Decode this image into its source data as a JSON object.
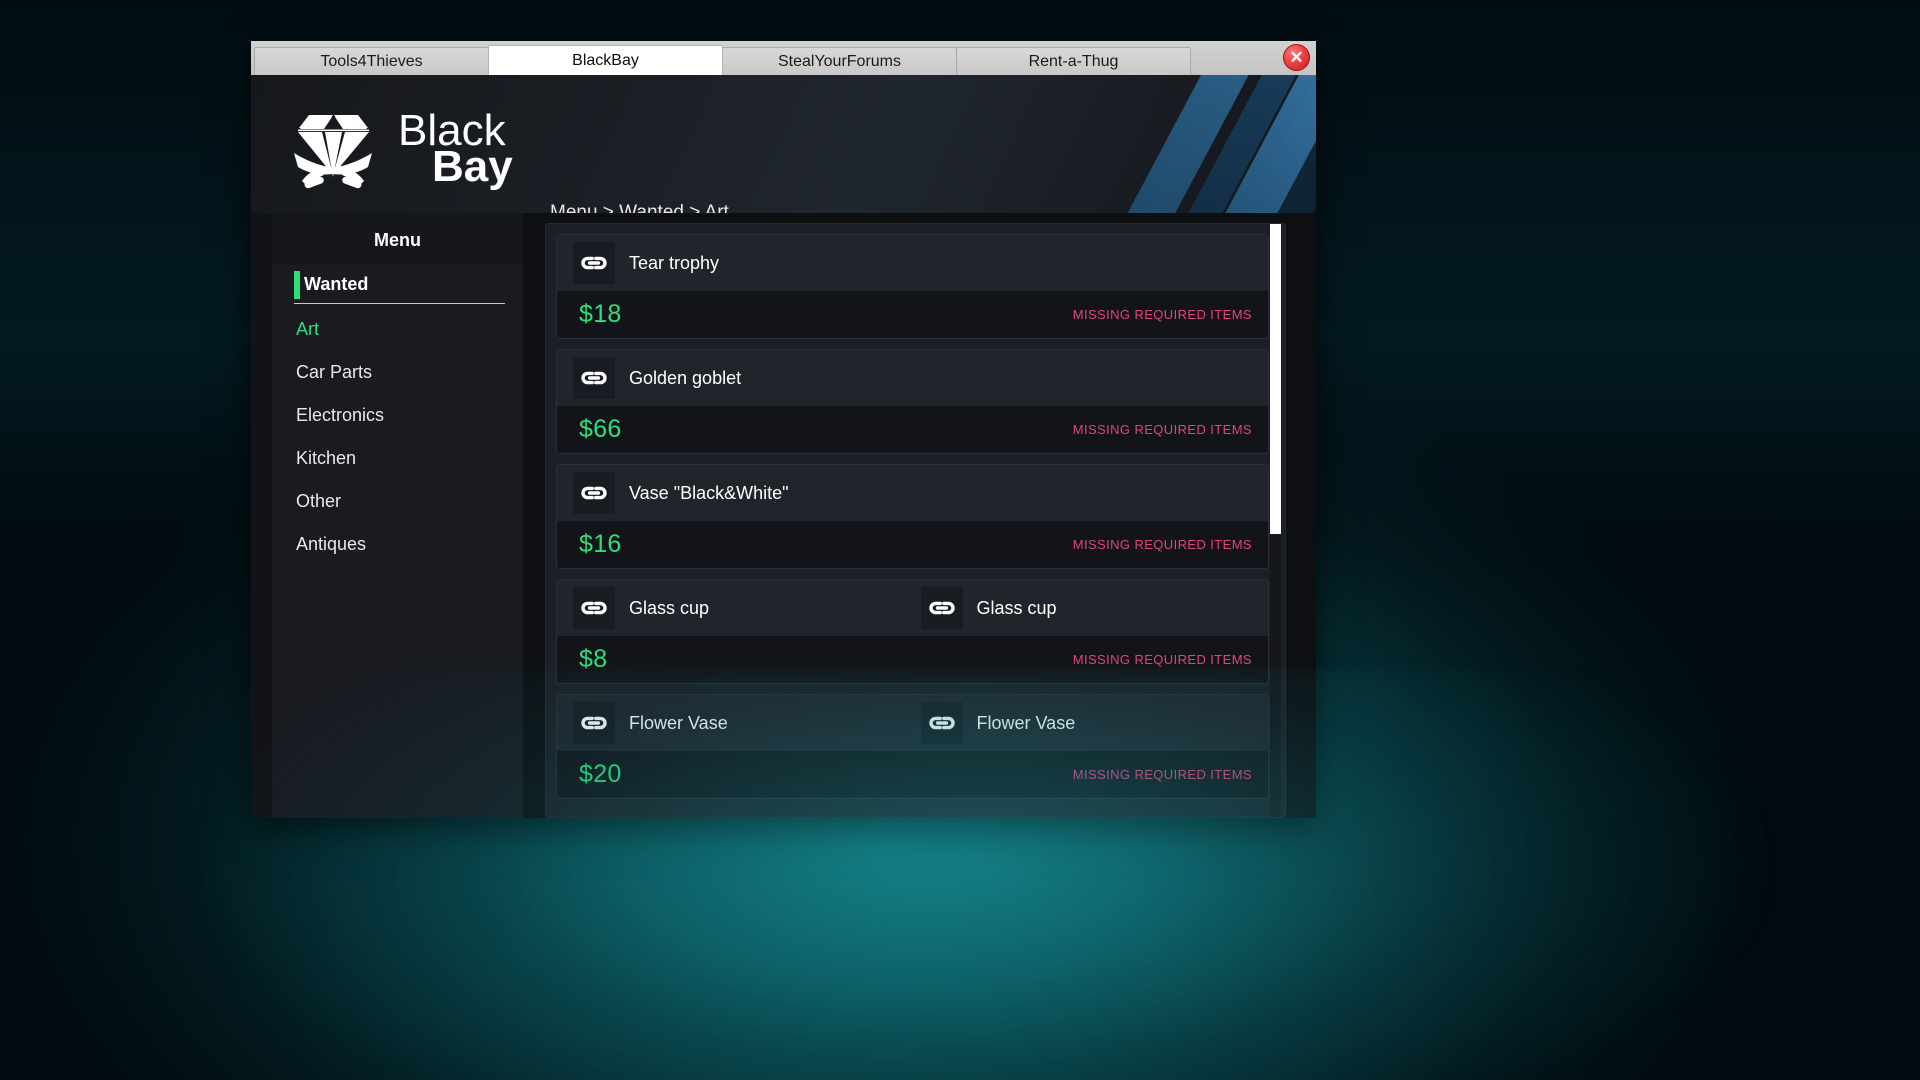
{
  "window": {
    "close_label": "✕"
  },
  "tabs": [
    {
      "label": "Tools4Thieves",
      "active": false
    },
    {
      "label": "BlackBay",
      "active": true
    },
    {
      "label": "StealYourForums",
      "active": false
    },
    {
      "label": "Rent-a-Thug",
      "active": false
    }
  ],
  "brand": {
    "line1": "Black",
    "line2": "Bay",
    "logo_icon": "diamond-crossed-sabers-icon"
  },
  "breadcrumb": "Menu > Wanted > Art",
  "sidebar": {
    "title": "Menu",
    "items": [
      {
        "label": "Wanted",
        "type": "header",
        "active": false
      },
      {
        "label": "Art",
        "type": "item",
        "active": true
      },
      {
        "label": "Car Parts",
        "type": "item",
        "active": false
      },
      {
        "label": "Electronics",
        "type": "item",
        "active": false
      },
      {
        "label": "Kitchen",
        "type": "item",
        "active": false
      },
      {
        "label": "Other",
        "type": "item",
        "active": false
      },
      {
        "label": "Antiques",
        "type": "item",
        "active": false
      }
    ]
  },
  "listing": {
    "status_label": "MISSING REQUIRED ITEMS",
    "item_icon": "chain-link-icon",
    "cards": [
      {
        "slots": [
          {
            "name": "Tear trophy"
          }
        ],
        "price": "$18",
        "status": "MISSING REQUIRED ITEMS"
      },
      {
        "slots": [
          {
            "name": "Golden goblet"
          }
        ],
        "price": "$66",
        "status": "MISSING REQUIRED ITEMS"
      },
      {
        "slots": [
          {
            "name": "Vase \"Black&White\""
          }
        ],
        "price": "$16",
        "status": "MISSING REQUIRED ITEMS"
      },
      {
        "slots": [
          {
            "name": "Glass cup"
          },
          {
            "name": "Glass cup"
          }
        ],
        "price": "$8",
        "status": "MISSING REQUIRED ITEMS"
      },
      {
        "slots": [
          {
            "name": "Flower Vase"
          },
          {
            "name": "Flower Vase"
          }
        ],
        "price": "$20",
        "status": "MISSING REQUIRED ITEMS"
      }
    ]
  },
  "colors": {
    "accent_green": "#2ee07a",
    "status_pink": "#e2437f",
    "panel_bg": "#1d1f26"
  }
}
